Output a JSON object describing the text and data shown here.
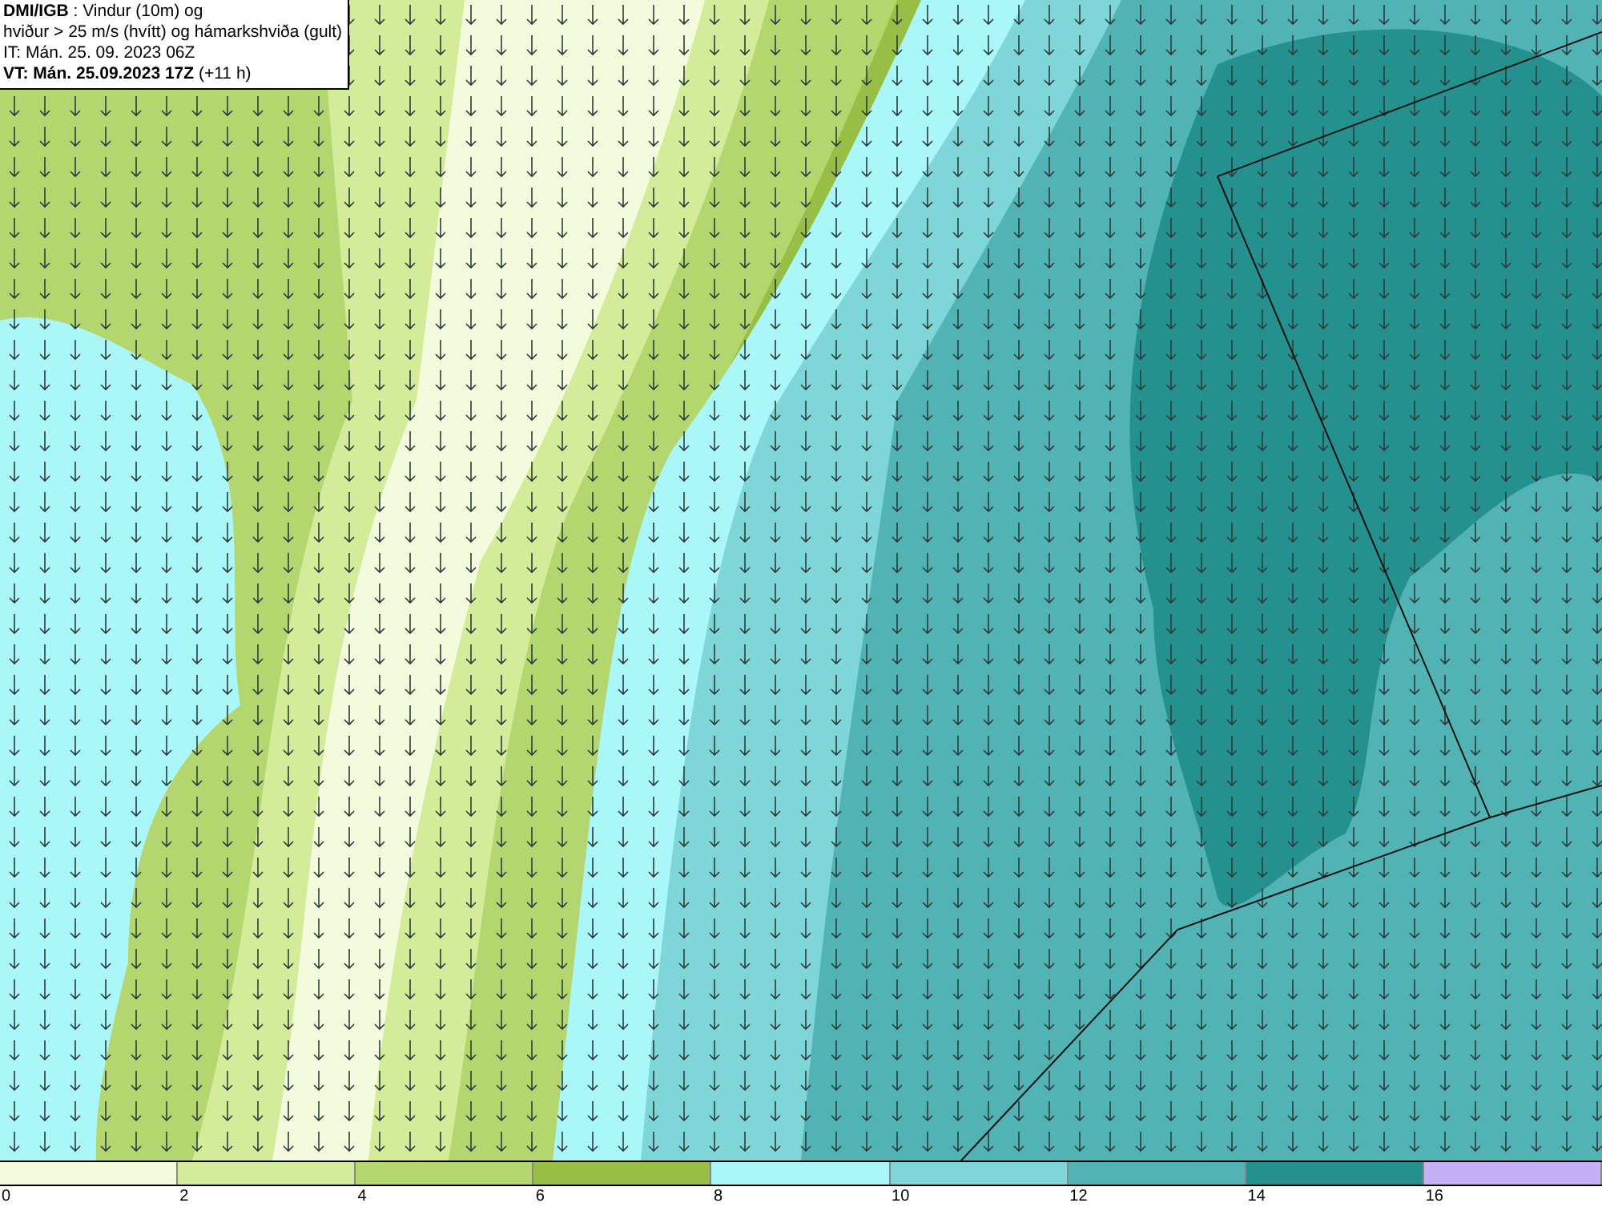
{
  "info_box": {
    "lines": [
      "**DMI/IGB** : Vindur (10m) og",
      "hviður > 25 m/s (hvítt) og hámarkshviða (gult)",
      "IT: Mán. 25. 09. 2023 06Z",
      "**VT: Mán. 25.09.2023 17Z** (+11 h)"
    ]
  },
  "legend": {
    "segments": [
      {
        "color": "#f4fbdc"
      },
      {
        "color": "#d4eb9a"
      },
      {
        "color": "#b3d76e"
      },
      {
        "color": "#98bf45"
      },
      {
        "color": "#aaf7fa"
      },
      {
        "color": "#7fd6d8"
      },
      {
        "color": "#52b3b5"
      },
      {
        "color": "#24918f"
      },
      {
        "color": "#c4b0f5"
      }
    ],
    "labels": [
      "0",
      "2",
      "4",
      "6",
      "8",
      "10",
      "12",
      "14",
      "16"
    ]
  }
}
